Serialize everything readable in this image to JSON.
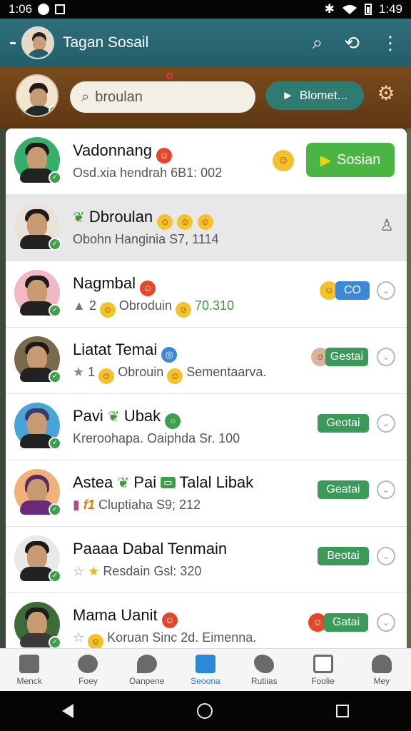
{
  "status_bar": {
    "time_left": "1:06",
    "time_right": "1:49"
  },
  "app_bar": {
    "title": "Tagan Sosail"
  },
  "header": {
    "search_text": "broulan",
    "pill_label": "Blomet..."
  },
  "list": [
    {
      "name": "Vadonnang",
      "sub": "Osd.xia hendrah 6B1: 002",
      "action": "Sosian"
    },
    {
      "name": "Dbroulan",
      "sub": "Obohn Hanginia S7, 1114"
    },
    {
      "name": "Nagmbal",
      "sub_prefix": "2",
      "sub_mid": "Obroduin",
      "sub_value": "70.310",
      "tag": "CO"
    },
    {
      "name": "Liatat Temai",
      "sub_prefix": "1",
      "sub_mid": "Obrouin",
      "sub_end": "Sementaarva.",
      "tag": "Gestai"
    },
    {
      "name": "Pavi",
      "name2": "Ubak",
      "sub": "Kreroohapa. Oaiphda Sr. 100",
      "tag": "Geotai"
    },
    {
      "name": "Astea",
      "name2": "Pai",
      "name3": "Talal Libak",
      "sub_prefix": "f1",
      "sub": "Cluptiaha S9; 212",
      "tag": "Geatai"
    },
    {
      "name": "Paaaa Dabal Tenmain",
      "sub": "Resdain Gsl: 320",
      "tag": "Beotai"
    },
    {
      "name": "Mama Uanit",
      "sub": "Koruan Sinc 2d. Eimenna.",
      "tag": "Gatai"
    }
  ],
  "bottom_nav": [
    "Menck",
    "Foey",
    "Oanpene",
    "Seoona",
    "Rutiias",
    "Foolie",
    "Mey"
  ],
  "colors": {
    "app_bar": "#2f6f7a",
    "accent_green": "#4bb543",
    "active_nav": "#2a8ad6"
  }
}
